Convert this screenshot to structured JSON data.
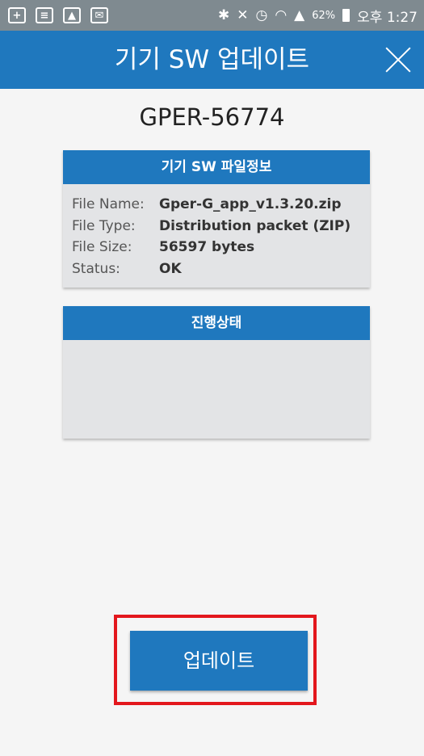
{
  "status_bar": {
    "notification_icons": [
      "plus-square-icon",
      "note-icon",
      "image-icon",
      "mail-icon"
    ],
    "system_icons": [
      "bluetooth-icon",
      "mute-icon",
      "alarm-icon",
      "wifi-icon",
      "signal-icon"
    ],
    "battery": "62%",
    "time": "오후 1:27"
  },
  "app_bar": {
    "title": "기기 SW 업데이트"
  },
  "device_id": "GPER-56774",
  "file_info": {
    "header": "기기 SW 파일정보",
    "rows": [
      {
        "key": "File Name:",
        "value": "Gper-G_app_v1.3.20.zip"
      },
      {
        "key": "File Type:",
        "value": "Distribution packet (ZIP)"
      },
      {
        "key": "File Size:",
        "value": "56597 bytes"
      },
      {
        "key": "Status:",
        "value": "OK"
      }
    ]
  },
  "progress": {
    "header": "진행상태"
  },
  "update_button": {
    "label": "업데이트"
  },
  "colors": {
    "brand_blue": "#1f78be",
    "highlight_red": "#e3171d",
    "status_bar": "#7f8a90"
  }
}
